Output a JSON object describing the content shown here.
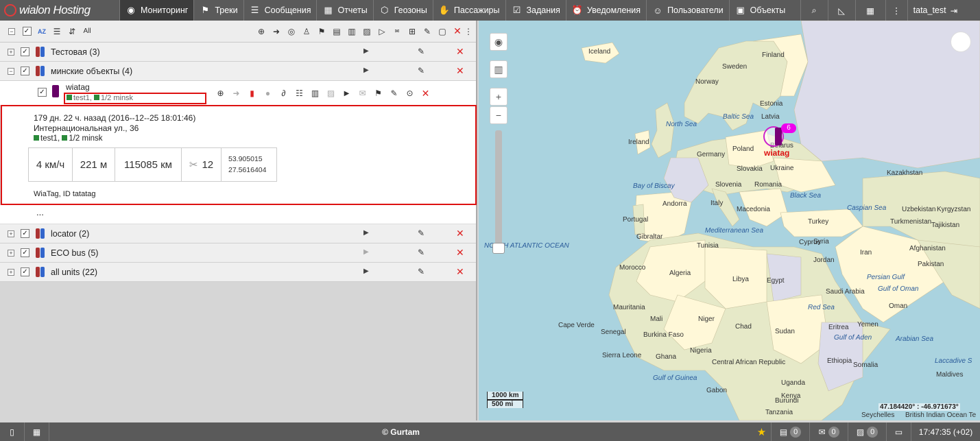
{
  "app": {
    "logo_text": "wialon Hosting",
    "user": "tata_test"
  },
  "nav": [
    {
      "label": "Мониторинг",
      "icon": "globe-icon",
      "glyph": "◉"
    },
    {
      "label": "Треки",
      "icon": "flag-icon",
      "glyph": "⚑"
    },
    {
      "label": "Сообщения",
      "icon": "list-icon",
      "glyph": "☰"
    },
    {
      "label": "Отчеты",
      "icon": "report-icon",
      "glyph": "▦"
    },
    {
      "label": "Геозоны",
      "icon": "geofence-icon",
      "glyph": "⬡"
    },
    {
      "label": "Пассажиры",
      "icon": "passenger-icon",
      "glyph": "✋"
    },
    {
      "label": "Задания",
      "icon": "task-icon",
      "glyph": "☑"
    },
    {
      "label": "Уведомления",
      "icon": "alarm-icon",
      "glyph": "⏰"
    },
    {
      "label": "Пользователи",
      "icon": "user-icon",
      "glyph": "☺"
    },
    {
      "label": "Объекты",
      "icon": "bus-icon",
      "glyph": "▣"
    }
  ],
  "toolbar": {
    "sort_label": "AZ",
    "all_label": "All"
  },
  "groups": [
    {
      "name": "Тестовая (3)"
    },
    {
      "name": "минские объекты (4)"
    },
    {
      "name": "locator (2)"
    },
    {
      "name": "ECO bus (5)"
    },
    {
      "name": "all units (22)"
    }
  ],
  "unit": {
    "name": "wiatag",
    "group1": "test1",
    "group2": "1/2 minsk",
    "last_message": "179 дн. 22 ч. назад (2016--12--25 18:01:46)",
    "address": "Интернациональная ул., 36",
    "speed": "4 км/ч",
    "altitude": "221 м",
    "mileage": "115085 км",
    "satellites": "12",
    "lat": "53.905015",
    "lon": "27.5616404",
    "device": "WiaTag, ID tatatag",
    "more": "..."
  },
  "map": {
    "labels": [
      {
        "text": "Iceland",
        "sea": false
      },
      {
        "text": "Finland",
        "sea": false
      },
      {
        "text": "Sweden",
        "sea": false
      },
      {
        "text": "Norway",
        "sea": false
      },
      {
        "text": "Estonia",
        "sea": false
      },
      {
        "text": "Latvia",
        "sea": false
      },
      {
        "text": "Baltic Sea",
        "sea": true
      },
      {
        "text": "North Sea",
        "sea": true
      },
      {
        "text": "Ireland",
        "sea": false
      },
      {
        "text": "Poland",
        "sea": false
      },
      {
        "text": "Germany",
        "sea": false
      },
      {
        "text": "Belarus",
        "sea": false
      },
      {
        "text": "Ukraine",
        "sea": false
      },
      {
        "text": "Slovakia",
        "sea": false
      },
      {
        "text": "Kazakhstan",
        "sea": false
      },
      {
        "text": "Bay of Biscay",
        "sea": true
      },
      {
        "text": "Slovenia",
        "sea": false
      },
      {
        "text": "Romania",
        "sea": false
      },
      {
        "text": "Andorra",
        "sea": false
      },
      {
        "text": "Italy",
        "sea": false
      },
      {
        "text": "Black Sea",
        "sea": true
      },
      {
        "text": "Caspian Sea",
        "sea": true
      },
      {
        "text": "Uzbekistan",
        "sea": false
      },
      {
        "text": "Kyrgyzstan",
        "sea": false
      },
      {
        "text": "Portugal",
        "sea": false
      },
      {
        "text": "Macedonia",
        "sea": false
      },
      {
        "text": "Turkey",
        "sea": false
      },
      {
        "text": "Turkmenistan",
        "sea": false
      },
      {
        "text": "Tajikistan",
        "sea": false
      },
      {
        "text": "Gibraltar",
        "sea": false
      },
      {
        "text": "Mediterranean Sea",
        "sea": true
      },
      {
        "text": "Tunisia",
        "sea": false
      },
      {
        "text": "Cyprus",
        "sea": false
      },
      {
        "text": "Syria",
        "sea": false
      },
      {
        "text": "NORTH ATLANTIC OCEAN",
        "sea": true
      },
      {
        "text": "Jordan",
        "sea": false
      },
      {
        "text": "Iran",
        "sea": false
      },
      {
        "text": "Afghanistan",
        "sea": false
      },
      {
        "text": "Morocco",
        "sea": false
      },
      {
        "text": "Pakistan",
        "sea": false
      },
      {
        "text": "Algeria",
        "sea": false
      },
      {
        "text": "Libya",
        "sea": false
      },
      {
        "text": "Egypt",
        "sea": false
      },
      {
        "text": "Persian Gulf",
        "sea": true
      },
      {
        "text": "Saudi Arabia",
        "sea": false
      },
      {
        "text": "Gulf of Oman",
        "sea": true
      },
      {
        "text": "Oman",
        "sea": false
      },
      {
        "text": "Red Sea",
        "sea": true
      },
      {
        "text": "Mauritania",
        "sea": false
      },
      {
        "text": "Mali",
        "sea": false
      },
      {
        "text": "Niger",
        "sea": false
      },
      {
        "text": "Chad",
        "sea": false
      },
      {
        "text": "Sudan",
        "sea": false
      },
      {
        "text": "Eritrea",
        "sea": false
      },
      {
        "text": "Yemen",
        "sea": false
      },
      {
        "text": "Cape Verde",
        "sea": false
      },
      {
        "text": "Senegal",
        "sea": false
      },
      {
        "text": "Burkina Faso",
        "sea": false
      },
      {
        "text": "Gulf of Aden",
        "sea": true
      },
      {
        "text": "Arabian Sea",
        "sea": true
      },
      {
        "text": "Nigeria",
        "sea": false
      },
      {
        "text": "Sierra Leone",
        "sea": false
      },
      {
        "text": "Ghana",
        "sea": false
      },
      {
        "text": "Ethiopia",
        "sea": false
      },
      {
        "text": "Central African Republic",
        "sea": false
      },
      {
        "text": "Somalia",
        "sea": false
      },
      {
        "text": "Laccadive S",
        "sea": true
      },
      {
        "text": "Maldives",
        "sea": false
      },
      {
        "text": "Gulf of Guinea",
        "sea": true
      },
      {
        "text": "Uganda",
        "sea": false
      },
      {
        "text": "Kenya",
        "sea": false
      },
      {
        "text": "Gabon",
        "sea": false
      },
      {
        "text": "Burundi",
        "sea": false
      },
      {
        "text": "Tanzania",
        "sea": false
      },
      {
        "text": "Seychelles",
        "sea": false
      },
      {
        "text": "British Indian Ocean Te",
        "sea": false
      }
    ],
    "scale_km": "1000 km",
    "scale_mi": "500 mi",
    "cursor_coords": "47.184420° : -46.971673°",
    "cluster_count": "6",
    "marker_name": "wiatag"
  },
  "status": {
    "copyright": "© Gurtam",
    "notif_count": "0",
    "msg_count": "0",
    "img_count": "0",
    "time": "17:47:35 (+02)"
  }
}
